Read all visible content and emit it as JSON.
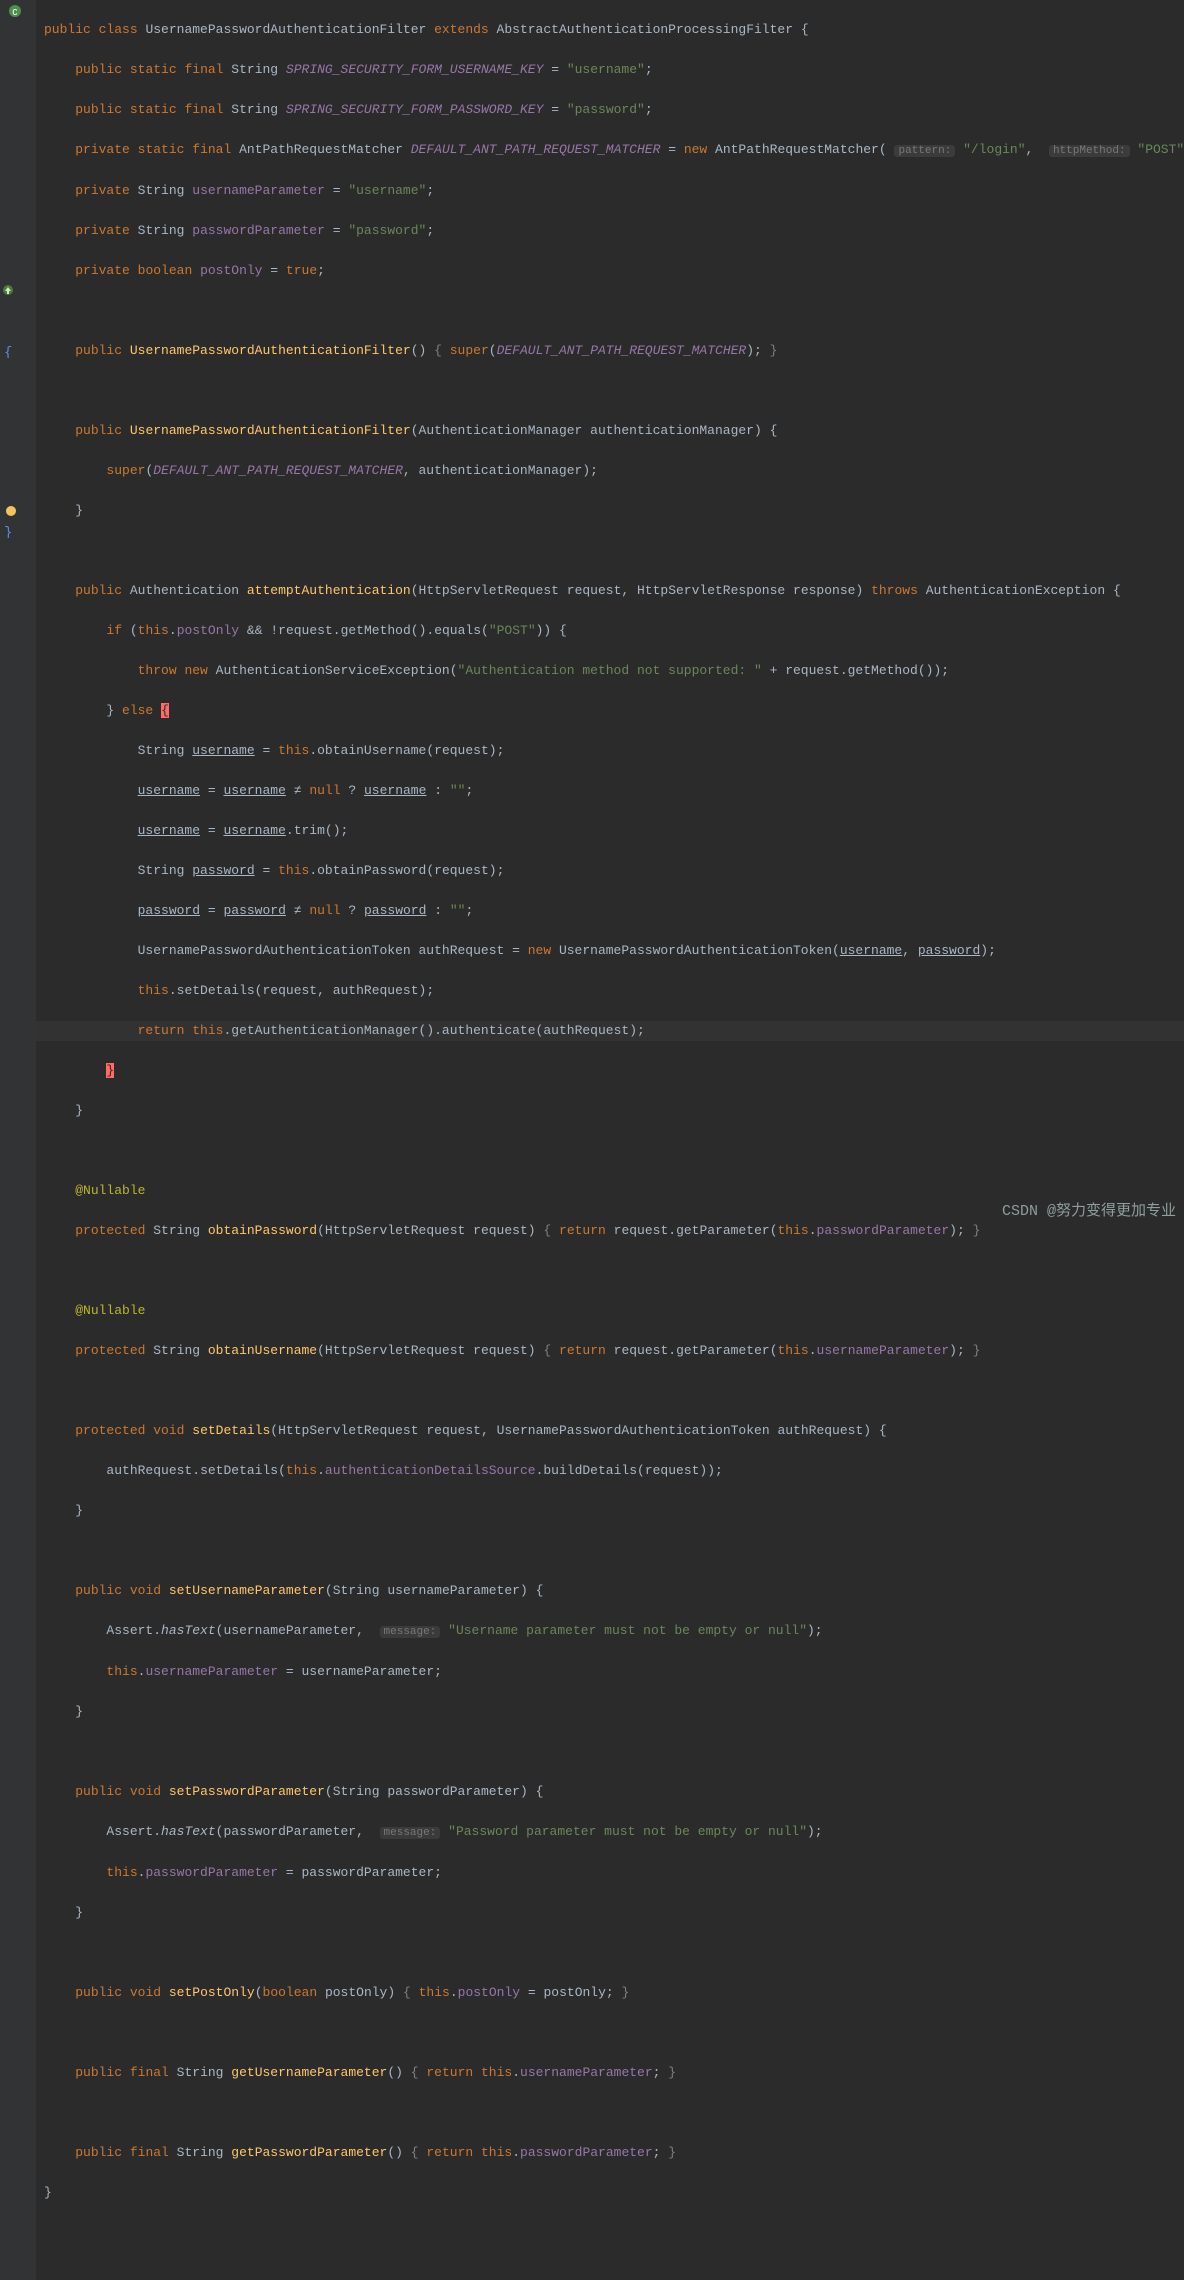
{
  "kw": {
    "public": "public",
    "class": "class",
    "extends": "extends",
    "static": "static",
    "final": "final",
    "private": "private",
    "new": "new",
    "void": "void",
    "boolean": "boolean",
    "return": "return",
    "if": "if",
    "else": "else",
    "super": "super",
    "this": "this",
    "throws": "throws",
    "protected": "protected",
    "true": "true",
    "null": "null"
  },
  "types": {
    "String": "String",
    "AntPathRequestMatcher": "AntPathRequestMatcher",
    "Authentication": "Authentication",
    "HttpServletRequest": "HttpServletRequest",
    "HttpServletResponse": "HttpServletResponse",
    "AuthenticationException": "AuthenticationException",
    "AuthenticationServiceException": "AuthenticationServiceException",
    "UsernamePasswordAuthenticationToken": "UsernamePasswordAuthenticationToken",
    "AuthenticationManager": "AuthenticationManager"
  },
  "cls": {
    "name": "UsernamePasswordAuthenticationFilter",
    "parent": "AbstractAuthenticationProcessingFilter"
  },
  "fields": {
    "userKey": "SPRING_SECURITY_FORM_USERNAME_KEY",
    "userKeyVal": "\"username\"",
    "passKey": "SPRING_SECURITY_FORM_PASSWORD_KEY",
    "passKeyVal": "\"password\"",
    "defMatcher": "DEFAULT_ANT_PATH_REQUEST_MATCHER",
    "usernameParameter": "usernameParameter",
    "usernameParamVal": "\"username\"",
    "passwordParameter": "passwordParameter",
    "passwordParamVal": "\"password\"",
    "postOnly": "postOnly"
  },
  "hints": {
    "pattern": "pattern:",
    "httpMethod": "httpMethod:",
    "message": "message:"
  },
  "strings": {
    "login": "\"/login\"",
    "POST": "\"POST\"",
    "POST2": "\"POST\"",
    "authNotSupported": "\"Authentication method not supported: \"",
    "empty": "\"\"",
    "userMsg": "\"Username parameter must not be empty or null\"",
    "passMsg": "\"Password parameter must not be empty or null\""
  },
  "methods": {
    "attemptAuthentication": "attemptAuthentication",
    "obtainPassword": "obtainPassword",
    "obtainUsername": "obtainUsername",
    "setDetails": "setDetails",
    "setUsernameParameter": "setUsernameParameter",
    "setPasswordParameter": "setPasswordParameter",
    "setPostOnly": "setPostOnly",
    "getUsernameParameter": "getUsernameParameter",
    "getPasswordParameter": "getPasswordParameter",
    "getMethod": "getMethod",
    "equals": "equals",
    "trim": "trim",
    "getAuthenticationManager": "getAuthenticationManager",
    "authenticate": "authenticate",
    "getParameter": "getParameter",
    "buildDetails": "buildDetails",
    "hasText": "hasText"
  },
  "vars": {
    "request": "request",
    "response": "response",
    "username": "username",
    "password": "password",
    "authRequest": "authRequest",
    "authenticationManager": "authenticationManager",
    "usernameParameter": "usernameParameter",
    "passwordParameter": "passwordParameter",
    "postOnly": "postOnly"
  },
  "misc": {
    "Assert": "Assert",
    "authenticationDetailsSource": "authenticationDetailsSource",
    "Nullable": "@Nullable",
    "ne": "≠",
    "q": "?",
    ":": ":"
  },
  "watermark": "CSDN @努力变得更加专业"
}
